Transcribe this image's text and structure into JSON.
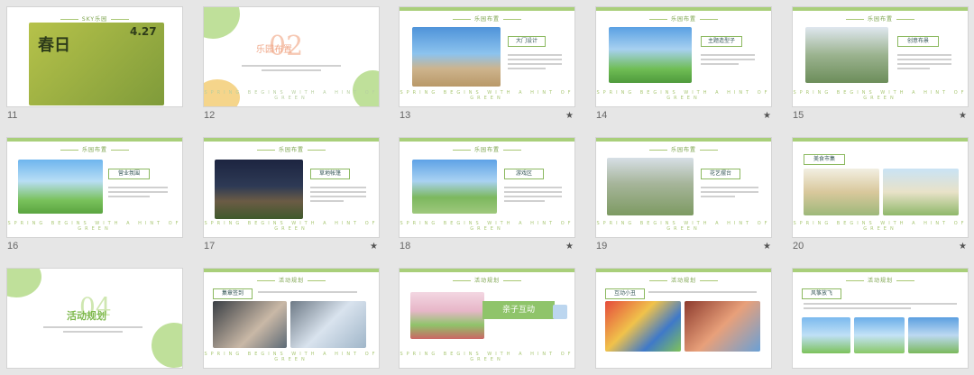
{
  "thumbnails": [
    {
      "number": "11",
      "star": false,
      "title": "",
      "cover_date": "4.27"
    },
    {
      "number": "12",
      "star": false,
      "big": "02",
      "section": "乐园布置"
    },
    {
      "number": "13",
      "star": true,
      "title": "乐园布置",
      "tag": "大门设计"
    },
    {
      "number": "14",
      "star": true,
      "title": "乐园布置",
      "tag": "主题造型子"
    },
    {
      "number": "15",
      "star": true,
      "title": "乐园布置",
      "tag": "创意布景"
    },
    {
      "number": "16",
      "star": false,
      "title": "乐园布置",
      "tag": "营业氛围"
    },
    {
      "number": "17",
      "star": true,
      "title": "乐园布置",
      "tag": "草地帐篷"
    },
    {
      "number": "18",
      "star": true,
      "title": "乐园布置",
      "tag": "游戏区"
    },
    {
      "number": "19",
      "star": true,
      "title": "乐园布置",
      "tag": "花艺摆台"
    },
    {
      "number": "20",
      "star": true,
      "title": "乐园布置",
      "tag": "美食市集"
    },
    {
      "number": "",
      "star": false,
      "big": "04",
      "section": "活动规划"
    },
    {
      "number": "",
      "star": false,
      "title": "活动规划",
      "tag": "集章签到"
    },
    {
      "number": "",
      "star": false,
      "title": "活动规划",
      "tag": "亲子互动"
    },
    {
      "number": "",
      "star": false,
      "title": "活动规划",
      "tag": "互动小丑"
    },
    {
      "number": "",
      "star": false,
      "title": "活动规划",
      "tag": "风筝放飞"
    }
  ],
  "footer_text": "SPRING BEGINS WITH A HINT OF GREEN",
  "star_glyph": "★",
  "colors": {
    "green": "#8fc46a",
    "light_green": "#c8e0a6",
    "peach": "#f6c8b3",
    "yellow": "#f5c96a"
  }
}
